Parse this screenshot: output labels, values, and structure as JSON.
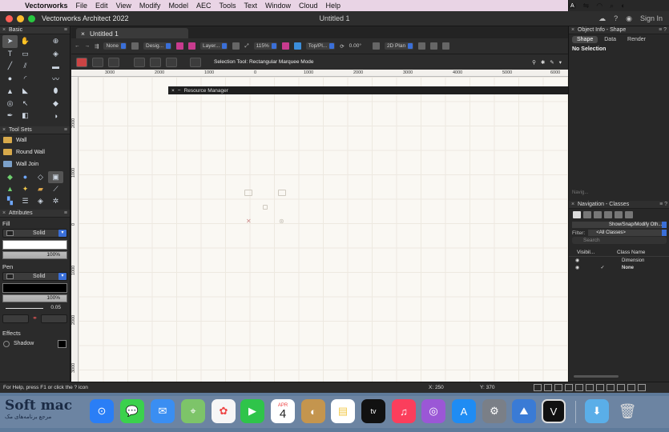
{
  "menubar": {
    "app_name": "Vectorworks",
    "items": [
      "File",
      "Edit",
      "View",
      "Modify",
      "Model",
      "AEC",
      "Tools",
      "Text",
      "Window",
      "Cloud",
      "Help"
    ],
    "right_badge": "A"
  },
  "window": {
    "app_title": "Vectorworks Architect 2022",
    "doc_title": "Untitled 1",
    "sign_in": "Sign In",
    "tab_label": "Untitled 1"
  },
  "basic_palette": {
    "title": "Basic"
  },
  "tool_sets": {
    "title": "Tool Sets",
    "items": [
      "Wall",
      "Round Wall",
      "Wall Join"
    ]
  },
  "attributes": {
    "title": "Attributes",
    "fill_label": "Fill",
    "fill_style": "Solid",
    "fill_opacity": "100%",
    "pen_label": "Pen",
    "pen_style": "Solid",
    "pen_opacity": "100%",
    "pen_thickness": "0.05",
    "effects_label": "Effects",
    "shadow_label": "Shadow"
  },
  "view_bar": {
    "class_dd": "None",
    "design_dd": "Desig...",
    "layer_dd": "Layer...",
    "zoom": "115%",
    "view_dd": "Top/Pl...",
    "angle": "0.00°",
    "render_dd": "2D Plan"
  },
  "mode_bar": {
    "tooltip": "Selection Tool: Rectangular Marquee Mode"
  },
  "rulers": {
    "h_labels": [
      "3000",
      "2000",
      "1000",
      "0",
      "1000",
      "2000",
      "3000",
      "4000",
      "5000",
      "6000"
    ],
    "v_labels": [
      "2000",
      "1000",
      "0",
      "1000",
      "2000",
      "3000"
    ]
  },
  "resource_manager": {
    "title": "Resource Manager"
  },
  "object_info": {
    "title": "Object Info - Shape",
    "tabs": [
      "Shape",
      "Data",
      "Render"
    ],
    "selection": "No Selection"
  },
  "navigation": {
    "hint": "Navig...",
    "title": "Navigation - Classes",
    "dd1": "Show/Snap/Modify Oth...",
    "dd2": "<All Classes>",
    "filter_label": "Filter:",
    "search_placeholder": "Search",
    "col_visibility": "Visibil...",
    "col_class": "Class Name",
    "rows": [
      {
        "name": "Dimension",
        "active": ""
      },
      {
        "name": "None",
        "active": "✓"
      }
    ]
  },
  "status": {
    "help": "For Help, press F1 or click the ? icon",
    "x": "X: 250",
    "y": "Y: 370"
  },
  "dock": {
    "watermark": "Soft mac",
    "watermark_sub": "مرجع برنامه‌های مک",
    "calendar_month": "APR",
    "calendar_day": "4",
    "tv_label": "tv"
  }
}
